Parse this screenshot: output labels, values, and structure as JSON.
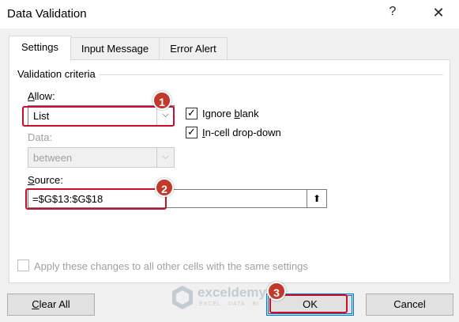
{
  "window": {
    "title": "Data Validation",
    "help_icon": "?",
    "close_icon": "✕"
  },
  "tabs": [
    {
      "label": "Settings",
      "active": true
    },
    {
      "label": "Input Message",
      "active": false
    },
    {
      "label": "Error Alert",
      "active": false
    }
  ],
  "criteria": {
    "group_label": "Validation criteria",
    "allow_label": "Allow:",
    "allow_value": "List",
    "ignore_blank_label": "Ignore blank",
    "ignore_blank_checked": true,
    "in_cell_dropdown_label": "In-cell drop-down",
    "in_cell_dropdown_checked": true,
    "data_label": "Data:",
    "data_value": "between",
    "source_label": "Source:",
    "source_value": "=$G$13:$G$18"
  },
  "apply_all_label": "Apply these changes to all other cells with the same settings",
  "buttons": {
    "clear_all": "Clear All",
    "ok": "OK",
    "cancel": "Cancel"
  },
  "badges": [
    "1",
    "2",
    "3"
  ],
  "watermark": {
    "name": "exceldemy",
    "tagline": "EXCEL · DATA · BI"
  },
  "colors": {
    "highlight": "#c8102e",
    "badge": "#c0392b",
    "default_button_border": "#0078d7"
  }
}
